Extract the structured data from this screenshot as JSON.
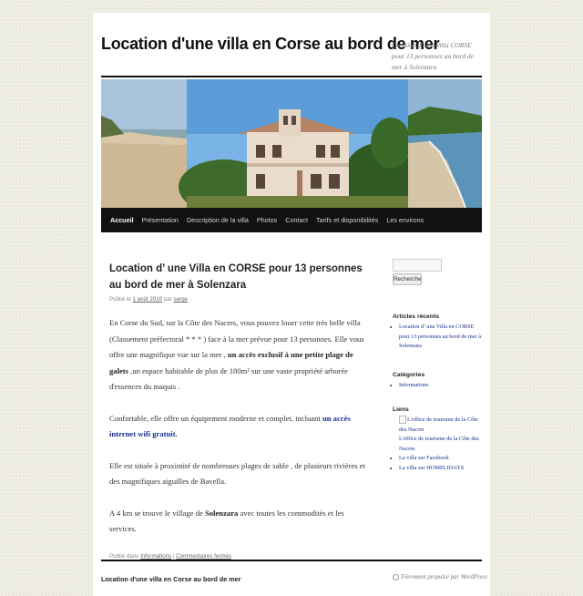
{
  "site": {
    "title": "Location d'une villa en Corse au bord de mer",
    "description": "Location d' une Villa CORSE pour 13 personnes au bord de mer à Solenzara"
  },
  "menu": {
    "items": [
      {
        "label": "Accueil",
        "active": true
      },
      {
        "label": "Présentation"
      },
      {
        "label": "Description de la villa"
      },
      {
        "label": "Photos"
      },
      {
        "label": "Contact"
      },
      {
        "label": "Tarifs et disponibilités"
      },
      {
        "label": "Les environs"
      }
    ]
  },
  "post": {
    "title": "Location d’ une Villa en CORSE pour 13 personnes au bord de mer à Solenzara",
    "meta_prefix": "Publié le",
    "date": "1 août 2010",
    "meta_by": "par",
    "author": "serge",
    "p1_a": "En Corse du Sud, sur la Côte des Nacres, vous pouvez louer cette très belle villa (Classement préfectoral * * * ) face à la mer prévue pour 13 personnes. Elle vous offre une magnifique vue sur la mer ,",
    "p1_b": "un accès exclusif à une petite plage de galets",
    "p1_c": ",un espace habitable de plus de 180m² sur une vaste propriété arborée d'essences du maquis .",
    "p2_a": "Confortable, elle offre un équipement moderne et complet, incluant",
    "p2_link": "un accès internet wifi gratuit.",
    "p3": "Elle est située à proximité de nombreuses plages de sable , de plusieurs rivières et des magnifiques aiguilles de Bavella.",
    "p4_a": "A 4 km se trouve le village de",
    "p4_b": "Solenzara",
    "p4_c": "avec toutes les commodités et les services.",
    "footer_prefix": "Publié dans",
    "category": "Informations",
    "separator": "|",
    "comments": "Commentaires fermés"
  },
  "sidebar": {
    "search_button": "Recherche",
    "recent_title": "Articles récents",
    "recent_items": [
      "Location d’ une Villa en CORSE pour 13 personnes au bord de mer à Solenzara"
    ],
    "categories_title": "Catégories",
    "categories_items": [
      "Informations"
    ],
    "links_title": "Liens",
    "links_img_alt": "L'office de tourisme de la Côte des Nacres",
    "links_items": [
      "L'office de tourisme de la Côte des Nacres",
      "La villa sur Facebook",
      "La villa sur HOMELIDAYS"
    ]
  },
  "footer": {
    "title": "Location d'une villa en Corse au bord de mer",
    "credit": "Fièrement propulsé par WordPress"
  }
}
